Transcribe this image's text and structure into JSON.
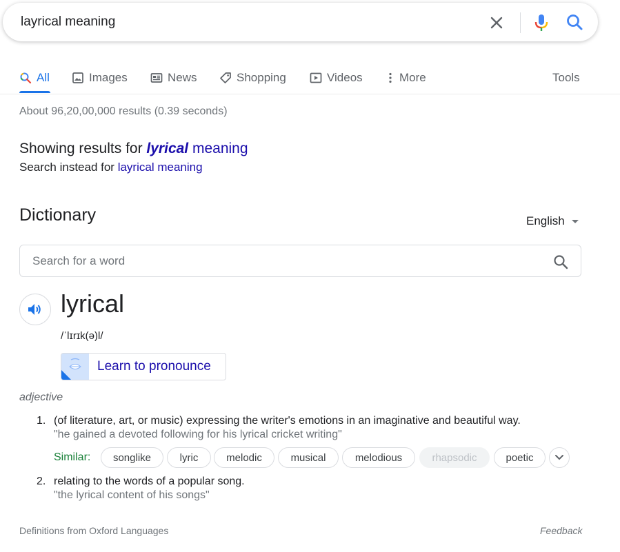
{
  "search": {
    "query": "layrical meaning",
    "icons": {
      "clear": "close-icon",
      "voice": "microphone-icon",
      "submit": "search-icon"
    }
  },
  "tabs": [
    {
      "label": "All",
      "icon": "search-icon",
      "active": true
    },
    {
      "label": "Images",
      "icon": "image-icon"
    },
    {
      "label": "News",
      "icon": "news-icon"
    },
    {
      "label": "Shopping",
      "icon": "tag-icon"
    },
    {
      "label": "Videos",
      "icon": "play-icon"
    },
    {
      "label": "More",
      "icon": "more-vert-icon"
    }
  ],
  "tools_label": "Tools",
  "result_stats": "About 96,20,00,000 results (0.39 seconds)",
  "spelling": {
    "showing_prefix": "Showing results for ",
    "corrected_bold": "lyrical",
    "corrected_rest": " meaning",
    "instead_prefix": "Search instead for ",
    "original_query": "layrical meaning"
  },
  "dictionary": {
    "title": "Dictionary",
    "language": "English",
    "search_placeholder": "Search for a word",
    "headword": "lyrical",
    "phonetic": "/ˈlɪrɪk(ə)l/",
    "pronounce_button": "Learn to pronounce",
    "part_of_speech": "adjective",
    "senses": [
      {
        "number": "1.",
        "definition": "(of literature, art, or music) expressing the writer's emotions in an imaginative and beautiful way.",
        "example": "\"he gained a devoted following for his lyrical cricket writing\""
      },
      {
        "number": "2.",
        "definition": "relating to the words of a popular song.",
        "example": "\"the lyrical content of his songs\""
      }
    ],
    "similar_label": "Similar:",
    "similar": [
      "songlike",
      "lyric",
      "melodic",
      "musical",
      "melodious",
      "rhapsodic",
      "poetic"
    ],
    "source": "Definitions from Oxford Languages",
    "feedback": "Feedback"
  },
  "colors": {
    "link": "#1a0dab",
    "accent": "#1a73e8",
    "similar_label": "#188038",
    "muted": "#70757a"
  }
}
